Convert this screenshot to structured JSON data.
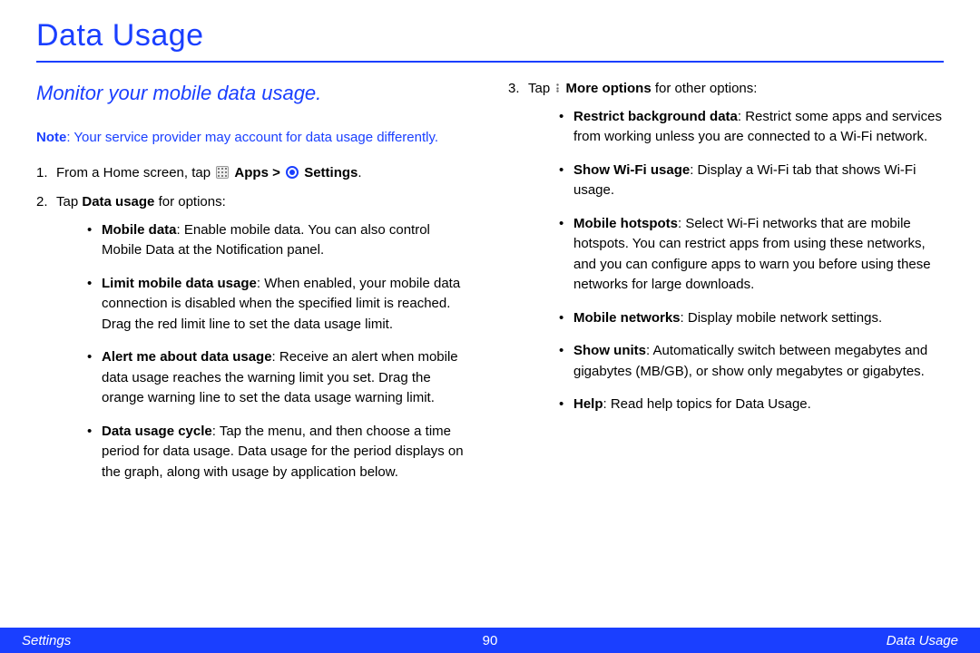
{
  "title": "Data Usage",
  "subtitle": "Monitor your mobile data usage.",
  "note_label": "Note",
  "note_text": ": Your service provider may account for data usage differently.",
  "step1_pre": "From a Home screen, tap ",
  "step1_apps": "Apps > ",
  "step1_settings": "Settings",
  "step1_post": ".",
  "step2_pre": " Tap ",
  "step2_bold": "Data usage",
  "step2_post": " for options:",
  "left_bullets": [
    {
      "label": "Mobile data",
      "text": ": Enable mobile data. You can also control Mobile Data at the Notification panel."
    },
    {
      "label": "Limit mobile data usage",
      "text": ": When enabled, your mobile data connection is disabled when the specified limit is reached. Drag the red limit line to set the data usage limit."
    },
    {
      "label": "Alert me about data usage",
      "text": ": Receive an alert when mobile data usage reaches the warning limit you set. Drag the orange warning line to set the data usage warning limit."
    },
    {
      "label": "Data usage cycle",
      "text": ": Tap the menu, and then choose a time period for data usage. Data usage for the period displays on the graph, along with usage by application below."
    }
  ],
  "step3_pre": "Tap ",
  "step3_bold": "More options",
  "step3_post": " for other options:",
  "right_bullets": [
    {
      "label": "Restrict background data",
      "text": ": Restrict some apps and services from working unless you are connected to a Wi-Fi network."
    },
    {
      "label": "Show Wi-Fi usage",
      "text": ": Display a Wi-Fi tab that shows Wi-Fi usage."
    },
    {
      "label": "Mobile hotspots",
      "text": ": Select Wi-Fi networks that are mobile hotspots. You can restrict apps from using these networks, and you can configure apps to warn you before using these networks for large downloads."
    },
    {
      "label": "Mobile networks",
      "text": ": Display mobile network settings."
    },
    {
      "label": "Show units",
      "text": ": Automatically switch between megabytes and gigabytes (MB/GB), or show only megabytes or gigabytes."
    },
    {
      "label": "Help",
      "text": ": Read help topics for Data Usage."
    }
  ],
  "footer": {
    "left": "Settings",
    "center": "90",
    "right": "Data Usage"
  }
}
